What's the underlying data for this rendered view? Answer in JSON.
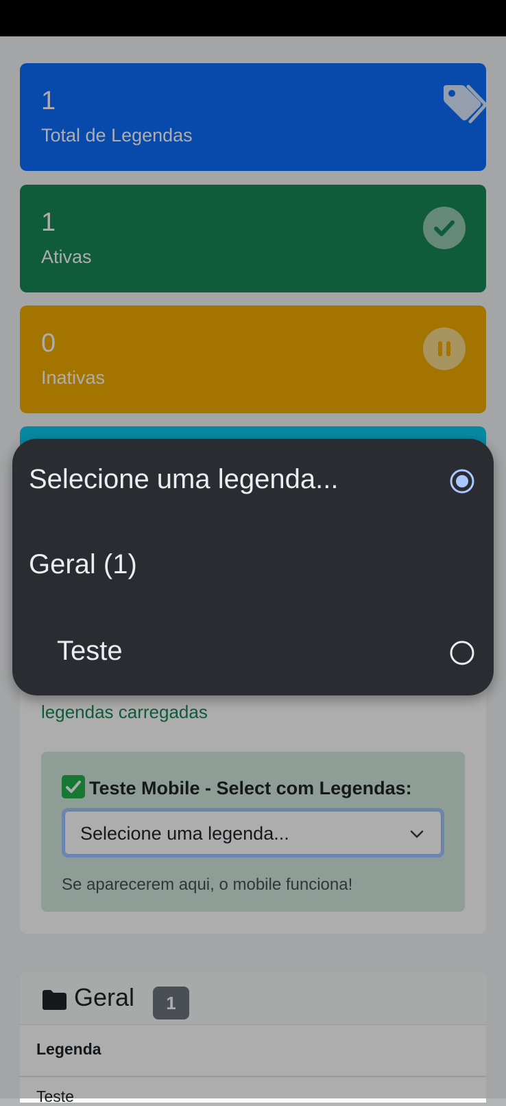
{
  "stats": [
    {
      "value": "1",
      "label": "Total de Legendas",
      "color": "#0d6efd",
      "icon": "tags-icon"
    },
    {
      "value": "1",
      "label": "Ativas",
      "color": "#198754",
      "icon": "check-circle-icon"
    },
    {
      "value": "0",
      "label": "Inativas",
      "color": "#f0ad00",
      "icon": "pause-circle-icon"
    }
  ],
  "filter": {
    "loaded_text": "legendas carregadas",
    "test_title": "Teste Mobile - Select com Legendas:",
    "select_value": "Selecione uma legenda...",
    "help_text": "Se aparecerem aqui, o mobile funciona!"
  },
  "group": {
    "title": "Geral",
    "count": "1",
    "column_header": "Legenda",
    "rows": [
      "Teste"
    ]
  },
  "dropdown": {
    "options": [
      {
        "label": "Selecione uma legenda...",
        "selected": true
      },
      {
        "label": "Geral (1)",
        "group": true
      },
      {
        "label": "Teste",
        "selected": false
      }
    ]
  }
}
